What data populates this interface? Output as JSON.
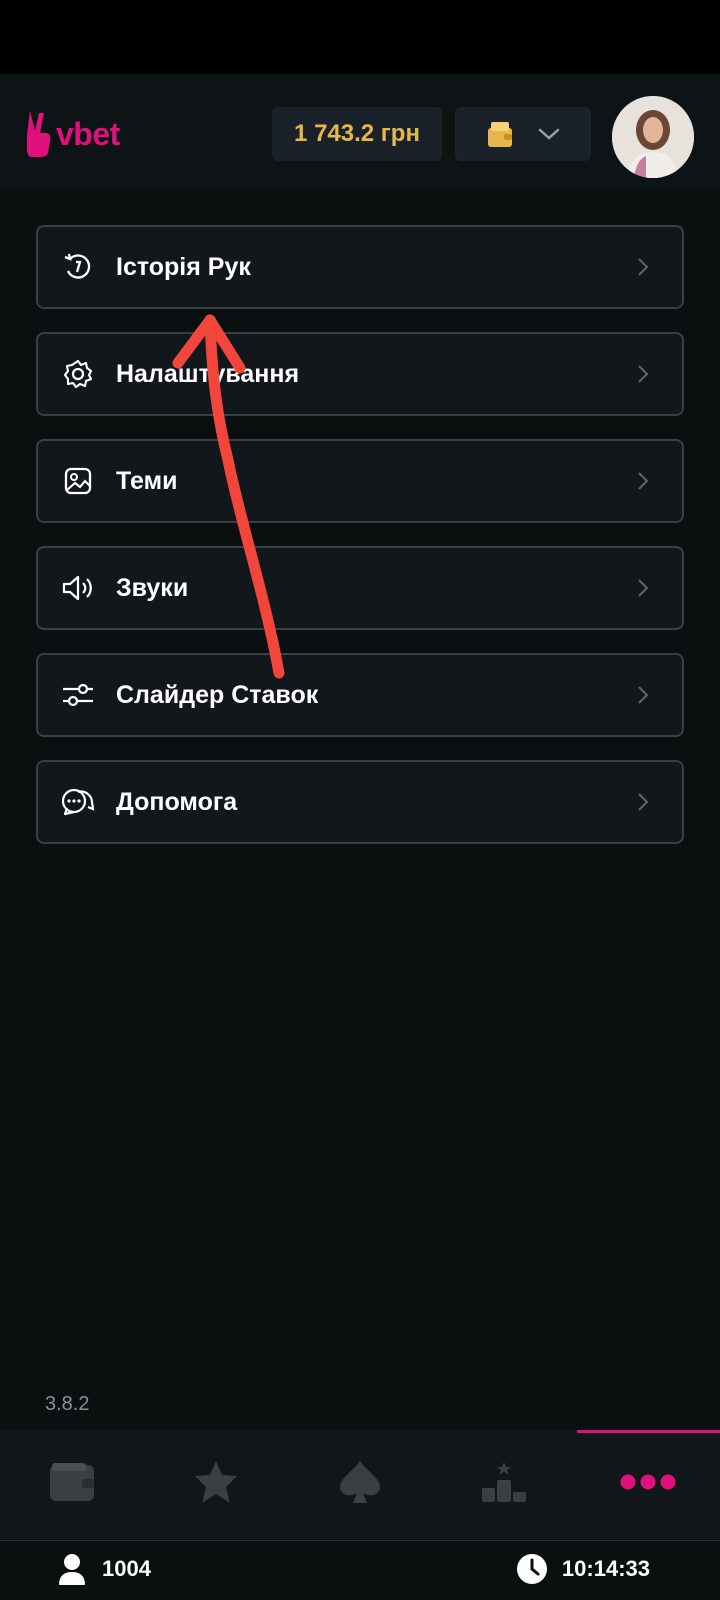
{
  "app": {
    "name": "vbet"
  },
  "header": {
    "balance": "1 743.2 грн",
    "wallet_icon": "wallet-icon",
    "dropdown_icon": "chevron-down-icon",
    "avatar_icon": "user-avatar"
  },
  "menu": {
    "items": [
      {
        "label": "Історія Рук",
        "icon": "history-icon"
      },
      {
        "label": "Налаштування",
        "icon": "gear-icon"
      },
      {
        "label": "Теми",
        "icon": "image-icon"
      },
      {
        "label": "Звуки",
        "icon": "speaker-icon"
      },
      {
        "label": "Слайдер Ставок",
        "icon": "sliders-icon"
      },
      {
        "label": "Допомога",
        "icon": "chat-icon"
      }
    ]
  },
  "version": "3.8.2",
  "tabs": [
    {
      "icon": "wallet-icon"
    },
    {
      "icon": "star-icon"
    },
    {
      "icon": "spade-icon"
    },
    {
      "icon": "leaderboard-icon"
    },
    {
      "icon": "more-icon",
      "active": true
    }
  ],
  "footer": {
    "players": "1004",
    "time": "10:14:33"
  },
  "colors": {
    "brand": "#e0107e",
    "balance": "#e6b84a",
    "annotation_arrow": "#f2463c"
  }
}
